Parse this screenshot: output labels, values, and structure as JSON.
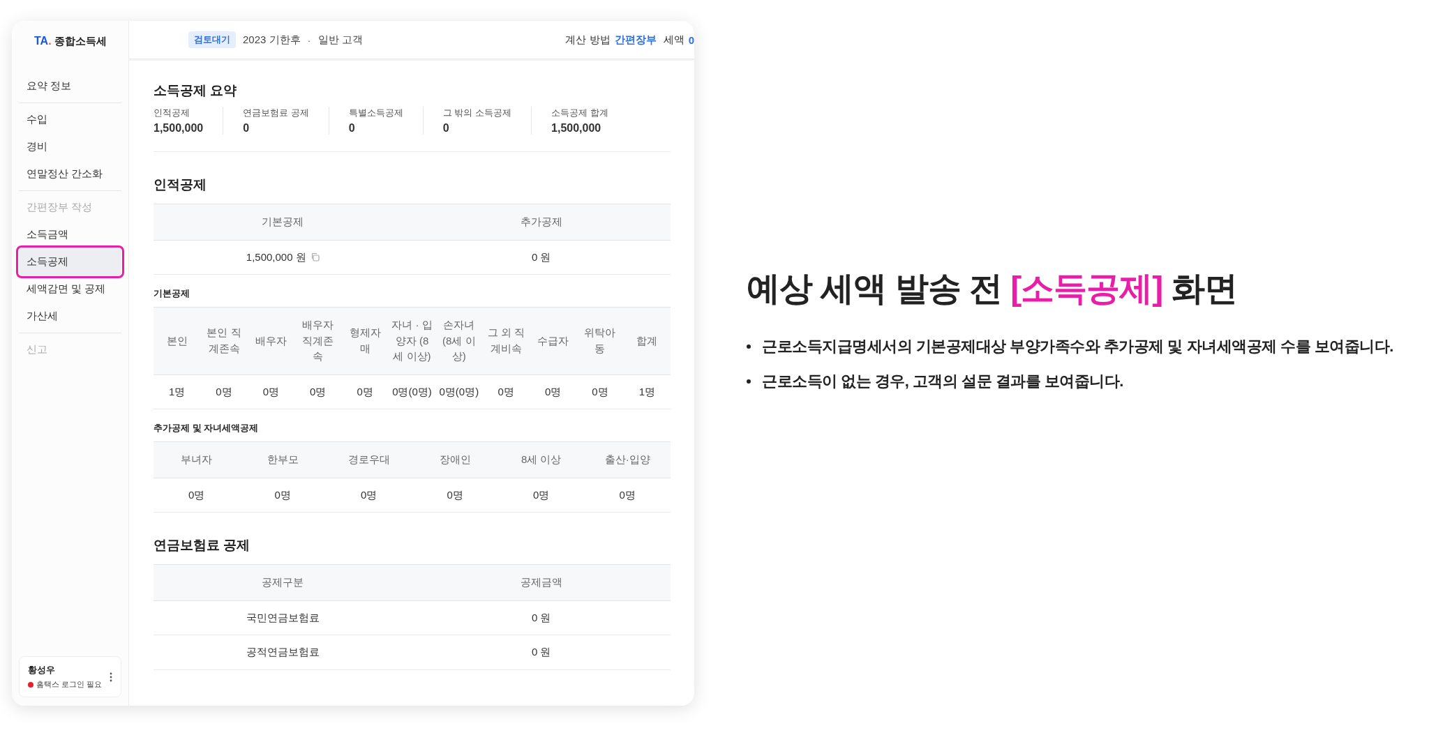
{
  "sidebar": {
    "logo": {
      "mark": "TA",
      "dot": ".",
      "title": "종합소득세"
    },
    "groups": [
      [
        {
          "label": "요약 정보",
          "selected": false,
          "disabled": false
        }
      ],
      [
        {
          "label": "수입",
          "selected": false,
          "disabled": false
        },
        {
          "label": "경비",
          "selected": false,
          "disabled": false
        },
        {
          "label": "연말정산 간소화",
          "selected": false,
          "disabled": false
        }
      ],
      [
        {
          "label": "간편장부 작성",
          "selected": false,
          "disabled": true
        },
        {
          "label": "소득금액",
          "selected": false,
          "disabled": false
        },
        {
          "label": "소득공제",
          "selected": true,
          "disabled": false
        },
        {
          "label": "세액감면 및 공제",
          "selected": false,
          "disabled": false
        },
        {
          "label": "가산세",
          "selected": false,
          "disabled": false
        }
      ],
      [
        {
          "label": "신고",
          "selected": false,
          "disabled": true
        }
      ]
    ],
    "user": {
      "name": "황성우",
      "status": "홈택스 로그인 필요",
      "logged_in": false
    }
  },
  "header": {
    "badge": "검토대기",
    "period": "2023 기한후",
    "separator": "·",
    "customer_type": "일반 고객",
    "method_label": "계산 방법",
    "method": "간편장부",
    "tax_label": "세액",
    "tax": "0"
  },
  "summary": {
    "title": "소득공제 요약",
    "items": [
      {
        "label": "인적공제",
        "value": "1,500,000"
      },
      {
        "label": "연금보험료 공제",
        "value": "0"
      },
      {
        "label": "특별소득공제",
        "value": "0"
      },
      {
        "label": "그 밖의 소득공제",
        "value": "0"
      },
      {
        "label": "소득공제 합계",
        "value": "1,500,000"
      }
    ]
  },
  "blocks": [
    {
      "kind": "heading",
      "text": "인적공제"
    },
    {
      "kind": "table",
      "columns": [
        "기본공제",
        "추가공제"
      ],
      "rows": [
        [
          {
            "text": "1,500,000 원",
            "copyable": true
          },
          "0 원"
        ]
      ]
    },
    {
      "kind": "subheading",
      "text": "기본공제"
    },
    {
      "kind": "table",
      "columns": [
        "본인",
        "본인 직계존속",
        "배우자",
        "배우자 직계존속",
        "형제자매",
        "자녀 · 입양자 (8세 이상)",
        "손자녀 (8세 이상)",
        "그 외 직계비속",
        "수급자",
        "위탁아동",
        "합계"
      ],
      "rows": [
        [
          "1명",
          "0명",
          "0명",
          "0명",
          "0명",
          "0명(0명)",
          "0명(0명)",
          "0명",
          "0명",
          "0명",
          "1명"
        ]
      ]
    },
    {
      "kind": "subheading",
      "text": "추가공제 및 자녀세액공제"
    },
    {
      "kind": "table",
      "columns": [
        "부녀자",
        "한부모",
        "경로우대",
        "장애인",
        "8세 이상",
        "출산·입양"
      ],
      "rows": [
        [
          "0명",
          "0명",
          "0명",
          "0명",
          "0명",
          "0명"
        ]
      ]
    },
    {
      "kind": "heading",
      "text": "연금보험료 공제"
    },
    {
      "kind": "table",
      "columns": [
        "공제구분",
        "공제금액"
      ],
      "rows": [
        [
          "국민연금보험료",
          "0 원"
        ],
        [
          "공적연금보험료",
          "0 원"
        ]
      ]
    }
  ],
  "caption": {
    "title": [
      {
        "text": "예상 세액 발송 전 ",
        "highlight": false
      },
      {
        "text": "[소득공제]",
        "highlight": true
      },
      {
        "text": " 화면",
        "highlight": false
      }
    ],
    "bullets": [
      "근로소득지급명세서의 기본공제대상 부양가족수와 추가공제 및 자녀세액공제 수를 보여줍니다.",
      "근로소득이 없는 경우, 고객의 설문 결과를 보여줍니다."
    ]
  }
}
